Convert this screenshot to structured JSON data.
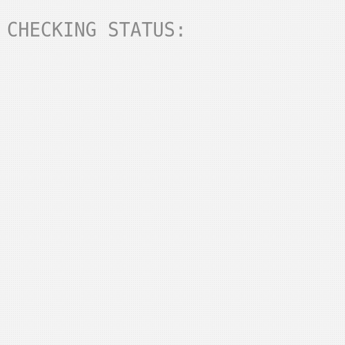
{
  "screen": {
    "heading": "CHECKING STATUS:",
    "colors": {
      "background": "#f4f4f4",
      "text": "#8a8a8a"
    }
  }
}
